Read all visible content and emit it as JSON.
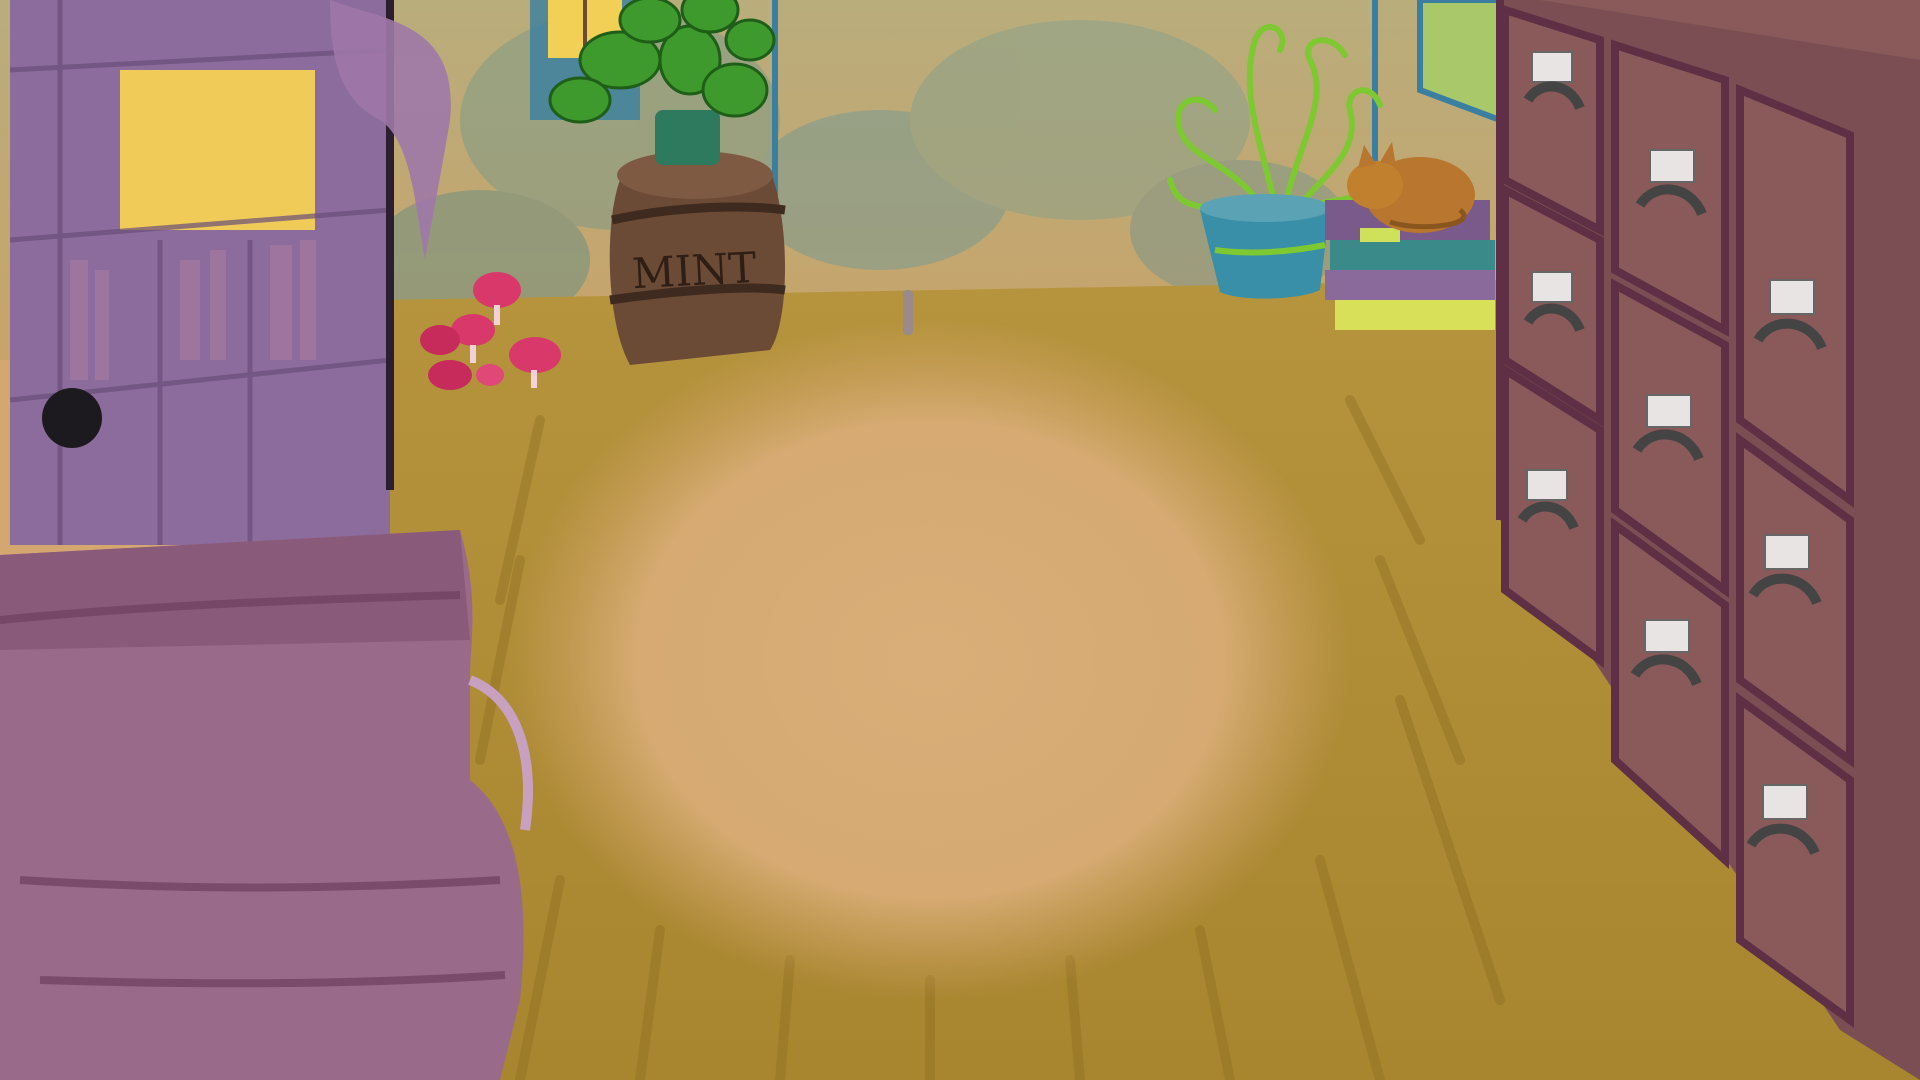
{
  "scene": {
    "barrel_label": "MINT",
    "colors": {
      "floor_light": "#d6aa74",
      "floor_shadow": "#a88434",
      "wall": "#c9b17a",
      "wall_mist": "#7e9a8a",
      "cabinet": "#7a4e52",
      "cabinet_outline": "#5e2f45",
      "bookshelf": "#8a6a9a",
      "sofa": "#9a6a8a",
      "barrel": "#6b4a36",
      "plant_green": "#3f9a2e",
      "pot_blue": "#3a8fa8",
      "mushroom": "#d8386a",
      "window_glow": "#f2cf55",
      "cat": "#b8762e"
    },
    "icons": {
      "door_knob": "door-knob-icon",
      "drawer_handle": "drawer-handle-icon",
      "drawer_label": "drawer-label-icon"
    }
  }
}
